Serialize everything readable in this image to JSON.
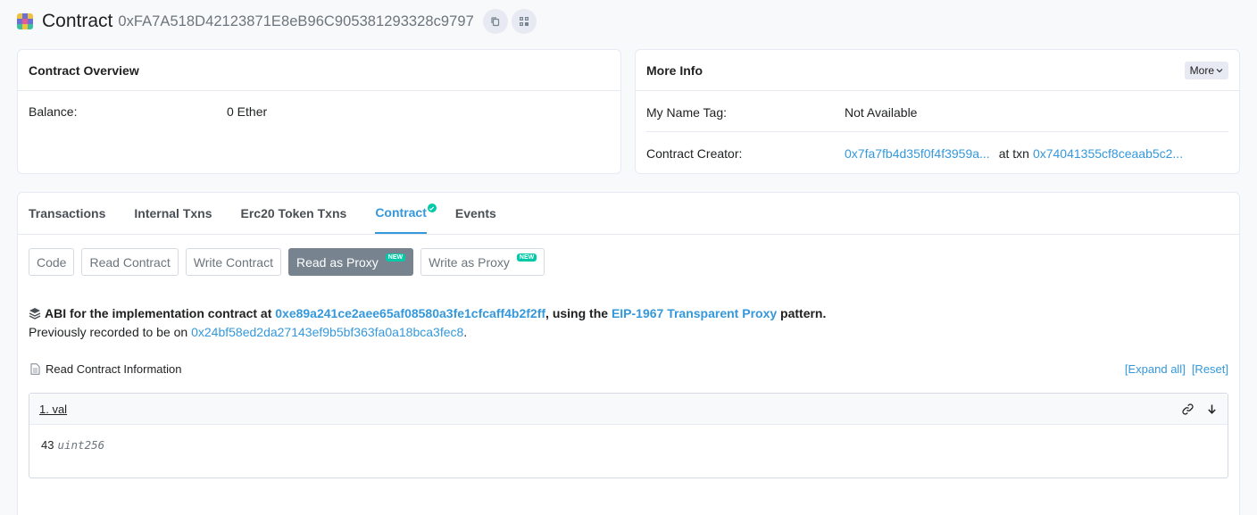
{
  "header": {
    "title": "Contract",
    "address": "0xFA7A518D42123871E8eB96C905381293328c9797",
    "copy_icon": "copy-icon",
    "qr_icon": "qr-code-icon"
  },
  "overview": {
    "title": "Contract Overview",
    "balance_label": "Balance:",
    "balance_value": "0 Ether"
  },
  "more_info": {
    "title": "More Info",
    "more_button": "More",
    "name_tag_label": "My Name Tag:",
    "name_tag_value": "Not Available",
    "creator_label": "Contract Creator:",
    "creator_address": "0x7fa7fb4d35f0f4f3959a...",
    "at_txn_label": "at txn",
    "creator_txn": "0x74041355cf8ceaab5c2..."
  },
  "tabs": [
    {
      "label": "Transactions"
    },
    {
      "label": "Internal Txns"
    },
    {
      "label": "Erc20 Token Txns"
    },
    {
      "label": "Contract",
      "active": true
    },
    {
      "label": "Events"
    }
  ],
  "subtabs": {
    "code": "Code",
    "read_contract": "Read Contract",
    "write_contract": "Write Contract",
    "read_as_proxy": "Read as Proxy",
    "write_as_proxy": "Write as Proxy",
    "new_badge": "NEW"
  },
  "proxy_info": {
    "abi_prefix": "ABI for the implementation contract at ",
    "implementation_address": "0xe89a241ce2aee65af08580a3fe1cfcaff4b2f2ff",
    "using_text": ", using the ",
    "proxy_pattern": "EIP-1967 Transparent Proxy",
    "pattern_suffix": " pattern.",
    "previous_prefix": "Previously recorded to be on ",
    "previous_address": "0x24bf58ed2da27143ef9b5bf363fa0a18bca3fec8",
    "previous_suffix": "."
  },
  "read_section": {
    "title": "Read Contract Information",
    "expand_all": "[Expand all]",
    "reset": "[Reset]"
  },
  "functions": [
    {
      "title": "1. val",
      "value": "43",
      "type": "uint256"
    }
  ],
  "colors": {
    "link": "#3498db",
    "active_subtab": "#77838f",
    "badge": "#00c9a7"
  }
}
